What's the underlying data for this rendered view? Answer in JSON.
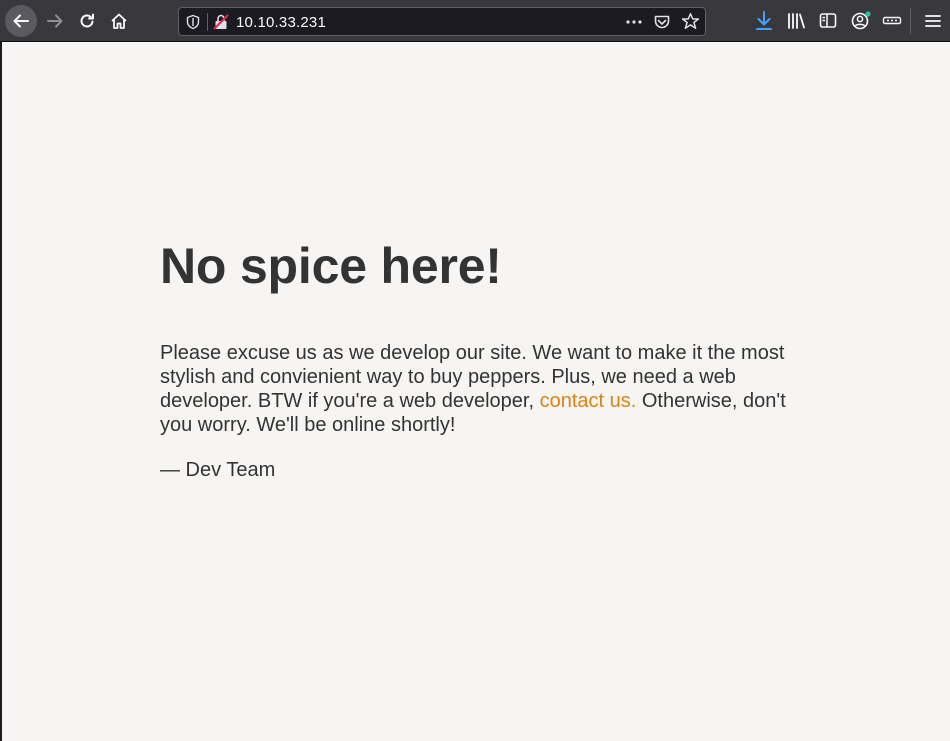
{
  "browser": {
    "url": "10.10.33.231",
    "colors": {
      "toolbar": "#38383d",
      "urlbar": "#1c1b22",
      "download_accent": "#45a1ff",
      "notification_dot": "#2ac3a2"
    },
    "icons": [
      "back-arrow-icon",
      "forward-arrow-icon",
      "reload-icon",
      "home-icon",
      "shield-icon",
      "insecure-lock-icon",
      "more-dots-icon",
      "pocket-icon",
      "star-icon",
      "download-icon",
      "library-icon",
      "sidebar-icon",
      "account-icon",
      "extensions-icon",
      "hamburger-menu-icon"
    ]
  },
  "page": {
    "heading": "No spice here!",
    "paragraph_before_link": "Please excuse us as we develop our site. We want to make it the most stylish and convienient way to buy peppers. Plus, we need a web developer. BTW if you're a web developer, ",
    "link_text": "contact us.",
    "paragraph_after_link": " Otherwise, don't you worry. We'll be online shortly!",
    "signature": "— Dev Team",
    "colors": {
      "background": "#f6f5f3",
      "text": "#333333",
      "link": "#dd8211"
    }
  }
}
